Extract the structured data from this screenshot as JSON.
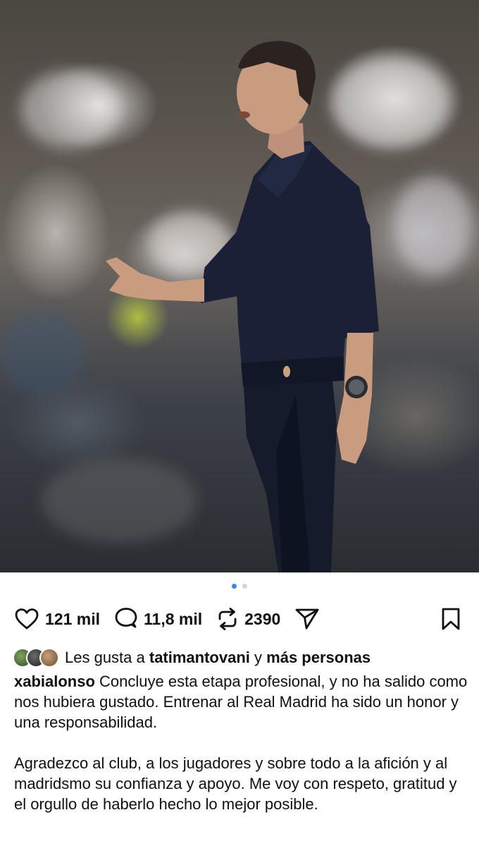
{
  "post": {
    "carousel": {
      "current_index": 1,
      "total": 2
    },
    "actions": {
      "like": {
        "icon": "heart-icon",
        "count": "121 mil"
      },
      "comment": {
        "icon": "comment-bubble-icon",
        "count": "11,8 mil"
      },
      "repost": {
        "icon": "repost-icon",
        "count": "2390"
      },
      "share": {
        "icon": "send-icon"
      },
      "save": {
        "icon": "bookmark-icon"
      }
    },
    "likes": {
      "prefix": "Les gusta a ",
      "user": "tatimantovani",
      "connector": " y ",
      "others": "más personas"
    },
    "caption": {
      "username": "xabialonso",
      "paragraph1": " Concluye esta etapa profesional, y no ha salido como nos hubiera gustado. Entrenar al Real Madrid ha sido un honor y una responsabilidad.",
      "paragraph2": "Agradezco al club, a los jugadores y sobre todo a la afición y al madridsmo su confianza y apoyo. Me voy con respeto, gratitud y el orgullo de haberlo hecho lo mejor posible."
    }
  },
  "colors": {
    "accent_dot": "#3b82f6",
    "inactive_dot": "#d4d4d8",
    "text": "#111111",
    "background": "#ffffff"
  }
}
